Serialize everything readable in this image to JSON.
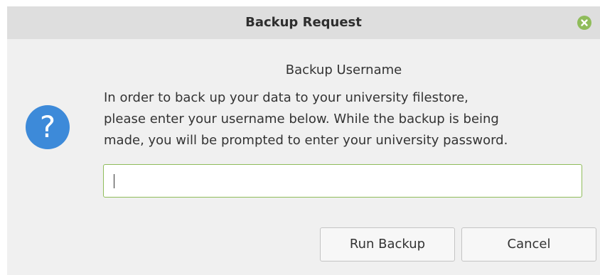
{
  "window": {
    "title": "Backup Request"
  },
  "dialog": {
    "icon": "question-icon",
    "heading": "Backup Username",
    "message": "In order to back up your data to your university filestore,\nplease enter your username below. While the backup is being\nmade, you will be prompted to enter your university password.",
    "username_value": ""
  },
  "buttons": {
    "run_backup": "Run Backup",
    "cancel": "Cancel"
  },
  "colors": {
    "accent": "#8fbc5a",
    "question_icon": "#3d8ad9",
    "titlebar": "#dedede",
    "background": "#f0f0f0"
  }
}
